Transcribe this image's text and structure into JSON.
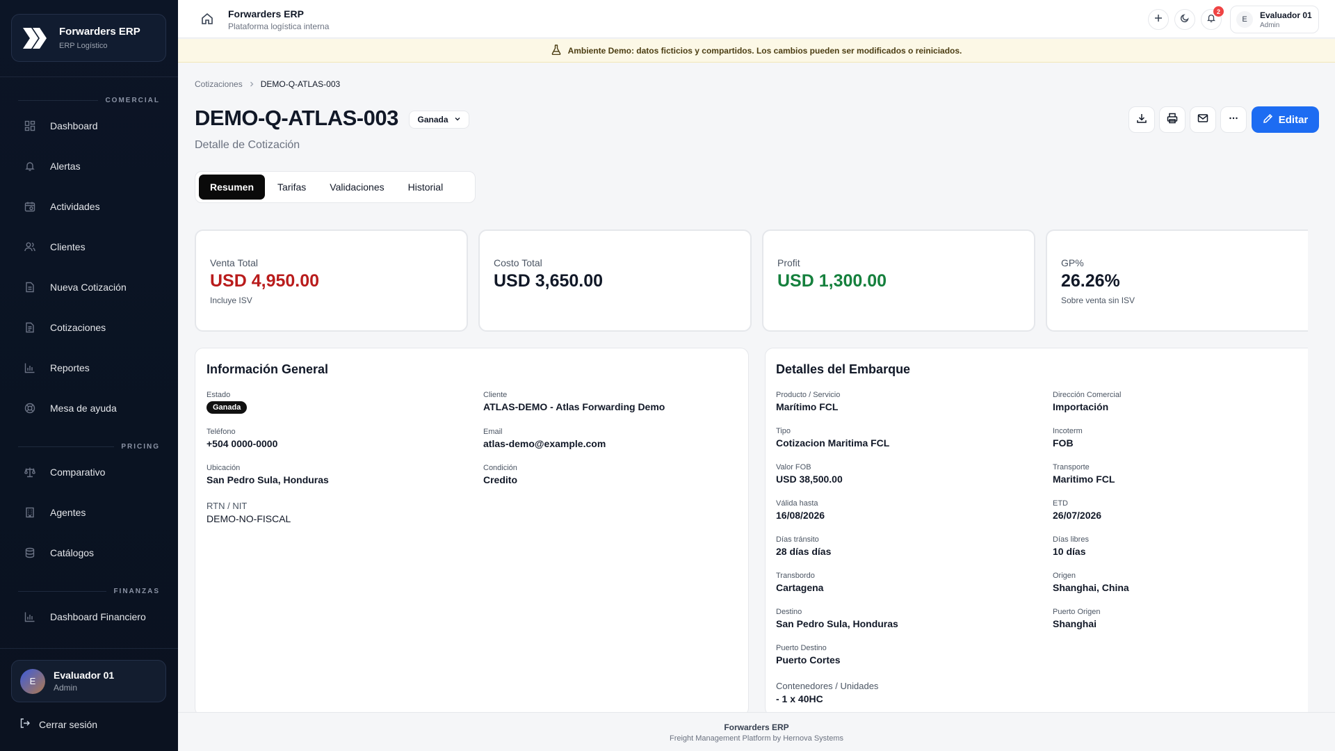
{
  "brand": {
    "title": "Forwarders ERP",
    "subtitle": "ERP Logístico"
  },
  "sidebar": {
    "sections": [
      {
        "label": "COMERCIAL",
        "items": [
          {
            "label": "Dashboard",
            "icon": "dashboard-icon"
          },
          {
            "label": "Alertas",
            "icon": "bell-icon"
          },
          {
            "label": "Actividades",
            "icon": "calendar-icon"
          },
          {
            "label": "Clientes",
            "icon": "users-icon"
          },
          {
            "label": "Nueva Cotización",
            "icon": "file-plus-icon"
          },
          {
            "label": "Cotizaciones",
            "icon": "file-text-icon"
          },
          {
            "label": "Reportes",
            "icon": "bar-chart-icon"
          },
          {
            "label": "Mesa de ayuda",
            "icon": "lifebuoy-icon"
          }
        ]
      },
      {
        "label": "PRICING",
        "items": [
          {
            "label": "Comparativo",
            "icon": "scale-icon"
          },
          {
            "label": "Agentes",
            "icon": "building-icon"
          },
          {
            "label": "Catálogos",
            "icon": "database-icon"
          }
        ]
      },
      {
        "label": "FINANZAS",
        "items": [
          {
            "label": "Dashboard Financiero",
            "icon": "bar-chart-icon"
          }
        ]
      }
    ],
    "user": {
      "initial": "E",
      "name": "Evaluador 01",
      "role": "Admin"
    },
    "logout_label": "Cerrar sesión"
  },
  "topbar": {
    "title": "Forwarders ERP",
    "subtitle": "Plataforma logística interna",
    "notification_count": "2",
    "user": {
      "initial": "E",
      "name": "Evaluador 01",
      "role": "Admin"
    }
  },
  "banner": {
    "text": "Ambiente Demo: datos ficticios y compartidos. Los cambios pueden ser modificados o reiniciados."
  },
  "breadcrumb": {
    "parent": "Cotizaciones",
    "current": "DEMO-Q-ATLAS-003"
  },
  "page": {
    "title": "DEMO-Q-ATLAS-003",
    "status": "Ganada",
    "subtitle": "Detalle de Cotización",
    "edit_label": "Editar"
  },
  "tabs": [
    {
      "label": "Resumen",
      "active": true
    },
    {
      "label": "Tarifas",
      "active": false
    },
    {
      "label": "Validaciones",
      "active": false
    },
    {
      "label": "Historial",
      "active": false
    }
  ],
  "kpis": [
    {
      "label": "Venta Total",
      "value": "USD 4,950.00",
      "foot": "Incluye ISV",
      "color": "#b91c1c"
    },
    {
      "label": "Costo Total",
      "value": "USD 3,650.00",
      "foot": "",
      "color": "#111827"
    },
    {
      "label": "Profit",
      "value": "USD 1,300.00",
      "foot": "",
      "color": "#15803d"
    },
    {
      "label": "GP%",
      "value": "26.26%",
      "foot": "Sobre venta sin ISV",
      "color": "#111827"
    }
  ],
  "general": {
    "title": "Información General",
    "estado_label": "Estado",
    "estado": "Ganada",
    "cliente_label": "Cliente",
    "cliente": "ATLAS-DEMO - Atlas Forwarding Demo",
    "telefono_label": "Teléfono",
    "telefono": "+504 0000-0000",
    "email_label": "Email",
    "email": "atlas-demo@example.com",
    "ubicacion_label": "Ubicación",
    "ubicacion": "San Pedro Sula, Honduras",
    "condicion_label": "Condición",
    "condicion": "Credito",
    "rtn_label": "RTN / NIT",
    "rtn": "DEMO-NO-FISCAL"
  },
  "shipment": {
    "title": "Detalles del Embarque",
    "producto_label": "Producto / Servicio",
    "producto": "Marítimo FCL",
    "direccion_label": "Dirección Comercial",
    "direccion": "Importación",
    "tipo_label": "Tipo",
    "tipo": "Cotizacion Maritima FCL",
    "incoterm_label": "Incoterm",
    "incoterm": "FOB",
    "fob_label": "Valor FOB",
    "fob": "USD 38,500.00",
    "transporte_label": "Transporte",
    "transporte": "Maritimo FCL",
    "valida_label": "Válida hasta",
    "valida": "16/08/2026",
    "etd_label": "ETD",
    "etd": "26/07/2026",
    "transito_label": "Días tránsito",
    "transito": "28 días días",
    "libres_label": "Días libres",
    "libres": "10 días",
    "transbordo_label": "Transbordo",
    "transbordo": "Cartagena",
    "origen_label": "Origen",
    "origen": "Shanghai, China",
    "destino_label": "Destino",
    "destino": "San Pedro Sula, Honduras",
    "puerto_origen_label": "Puerto Origen",
    "puerto_origen": "Shanghai",
    "puerto_destino_label": "Puerto Destino",
    "puerto_destino": "Puerto Cortes",
    "contenedores_label": "Contenedores / Unidades",
    "contenedores": "- 1 x 40HC"
  },
  "footer": {
    "title": "Forwarders ERP",
    "subtitle": "Freight Management Platform by Hernova Systems"
  }
}
